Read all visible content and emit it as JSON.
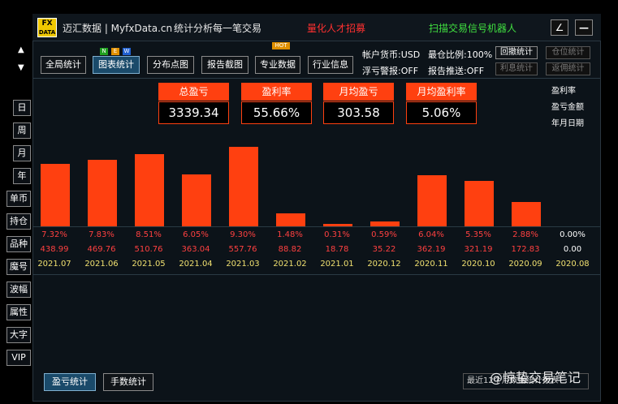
{
  "header": {
    "logo_line1": "FX",
    "logo_line2": "DATA",
    "brand": "迈汇数据 | MyfxData.cn",
    "subtitle": "统计分析每一笔交易",
    "recruit": "量化人才招募",
    "robot": "扫描交易信号机器人",
    "btn_edit": "∠",
    "btn_min": "—"
  },
  "nav": {
    "tabs": [
      {
        "label": "全局统计"
      },
      {
        "label": "图表统计"
      },
      {
        "label": "分布点图"
      },
      {
        "label": "报告截图"
      },
      {
        "label": "专业数据"
      },
      {
        "label": "行业信息"
      }
    ],
    "badges": [
      "N",
      "E",
      "W"
    ],
    "hot": "HOT"
  },
  "account": {
    "currency": "帐户货币:USD",
    "max_pos": "最仓比例:100%",
    "float_alert": "浮亏警报:OFF",
    "report_push": "报告推送:OFF"
  },
  "right_buttons": {
    "drawdown": "回撤统计",
    "position": "仓位统计",
    "interest": "利息统计",
    "rebate": "返佣统计"
  },
  "side": {
    "arrows": [
      "▲",
      "▼"
    ],
    "buttons": [
      "日",
      "周",
      "月",
      "年",
      "单币",
      "持仓",
      "品种",
      "魔号",
      "波幅",
      "属性",
      "大字",
      "VIP"
    ]
  },
  "stats": [
    {
      "label": "总盈亏",
      "value": "3339.34"
    },
    {
      "label": "盈利率",
      "value": "55.66%"
    },
    {
      "label": "月均盈亏",
      "value": "303.58"
    },
    {
      "label": "月均盈利率",
      "value": "5.06%"
    }
  ],
  "legend": [
    "盈利率",
    "盈亏金额",
    "年月日期"
  ],
  "chart_data": {
    "type": "bar",
    "categories": [
      "2021.07",
      "2021.06",
      "2021.05",
      "2021.04",
      "2021.03",
      "2021.02",
      "2021.01",
      "2020.12",
      "2020.11",
      "2020.10",
      "2020.09",
      "2020.08"
    ],
    "values": [
      438.99,
      469.76,
      510.76,
      363.04,
      557.76,
      88.82,
      18.78,
      35.22,
      362.19,
      321.19,
      172.83,
      0.0
    ],
    "percent_labels": [
      "7.32%",
      "7.83%",
      "8.51%",
      "6.05%",
      "9.30%",
      "1.48%",
      "0.31%",
      "0.59%",
      "6.04%",
      "5.35%",
      "2.88%",
      "0.00%"
    ],
    "amount_labels": [
      "438.99",
      "469.76",
      "510.76",
      "363.04",
      "557.76",
      "88.82",
      "18.78",
      "35.22",
      "362.19",
      "321.19",
      "172.83",
      "0.00"
    ],
    "bar_color": "#ff4010",
    "ylim": [
      0,
      600
    ]
  },
  "bottom": {
    "btn1": "盈亏统计",
    "btn2": "手数统计",
    "report_note": "最近12个月数据统计报表",
    "watermark": "@惊蛰交易笔记"
  }
}
